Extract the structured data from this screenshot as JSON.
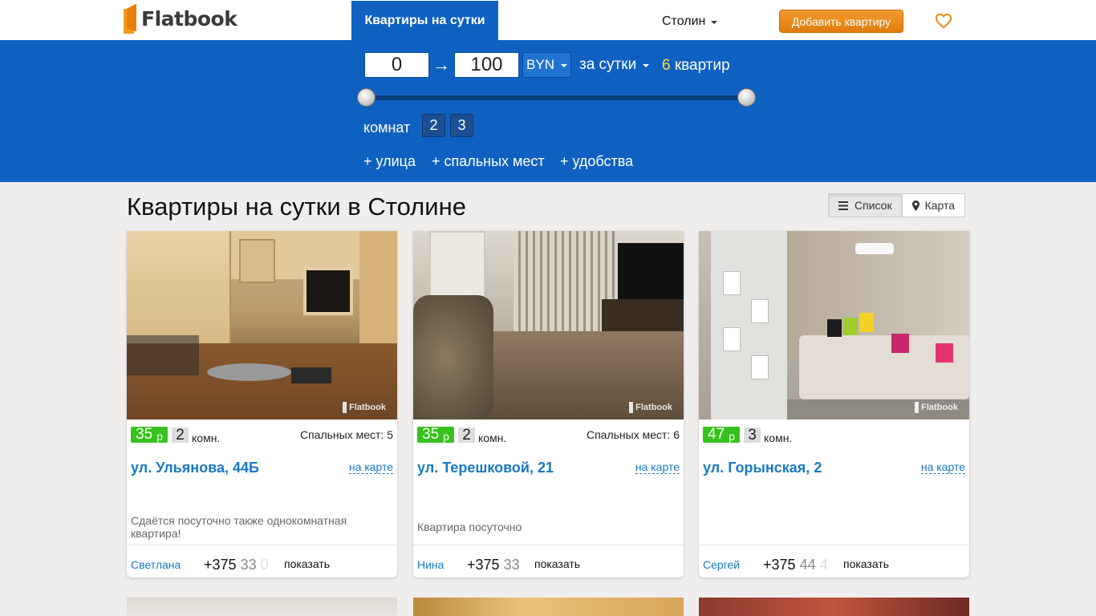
{
  "header": {
    "logo_text": "Flatbook",
    "nav_active": "Квартиры на сутки",
    "city": "Столин",
    "add_button": "Добавить квартиру"
  },
  "filter": {
    "price_min": "0",
    "price_max": "100",
    "arrow": "→",
    "currency": "BYN",
    "period": "за сутки",
    "count_num": "6",
    "count_word": "квартир",
    "rooms_label": "комнат",
    "rooms": [
      "2",
      "3"
    ],
    "more": [
      "+ улица",
      "+ спальных мест",
      "+ удобства"
    ]
  },
  "main": {
    "title": "Квартиры на сутки в Столине",
    "view_list": "Список",
    "view_map": "Карта"
  },
  "colors": {
    "brand_blue": "#0f61c1",
    "accent_orange": "#f0880f",
    "price_green": "#35c21c",
    "link_blue": "#1979c3"
  },
  "listings": [
    {
      "price": "35",
      "price_unit": "р",
      "rooms": "2",
      "rooms_word": "комн.",
      "beds": "Спальных мест: 5",
      "address": "ул. Ульянова, 44Б",
      "on_map": "на карте",
      "description": "Сдаётся посуточно также однокомнатная квартира!",
      "owner": "Светлана",
      "phone_start": "+375",
      "phone_mid": "33",
      "phone_end": "0",
      "show": "показать",
      "watermark": "Flatbook"
    },
    {
      "price": "35",
      "price_unit": "р",
      "rooms": "2",
      "rooms_word": "комн.",
      "beds": "Спальных мест: 6",
      "address": "ул. Терешковой, 21",
      "on_map": "на карте",
      "description": "Квартира посуточно",
      "owner": "Нина",
      "phone_start": "+375",
      "phone_mid": "33",
      "phone_end": "",
      "show": "показать",
      "watermark": "Flatbook"
    },
    {
      "price": "47",
      "price_unit": "р",
      "rooms": "3",
      "rooms_word": "комн.",
      "beds": "",
      "address": "ул. Горынская, 2",
      "on_map": "на карте",
      "description": "",
      "owner": "Сергей",
      "phone_start": "+375",
      "phone_mid": "44",
      "phone_end": "4",
      "show": "показать",
      "watermark": "Flatbook"
    }
  ]
}
